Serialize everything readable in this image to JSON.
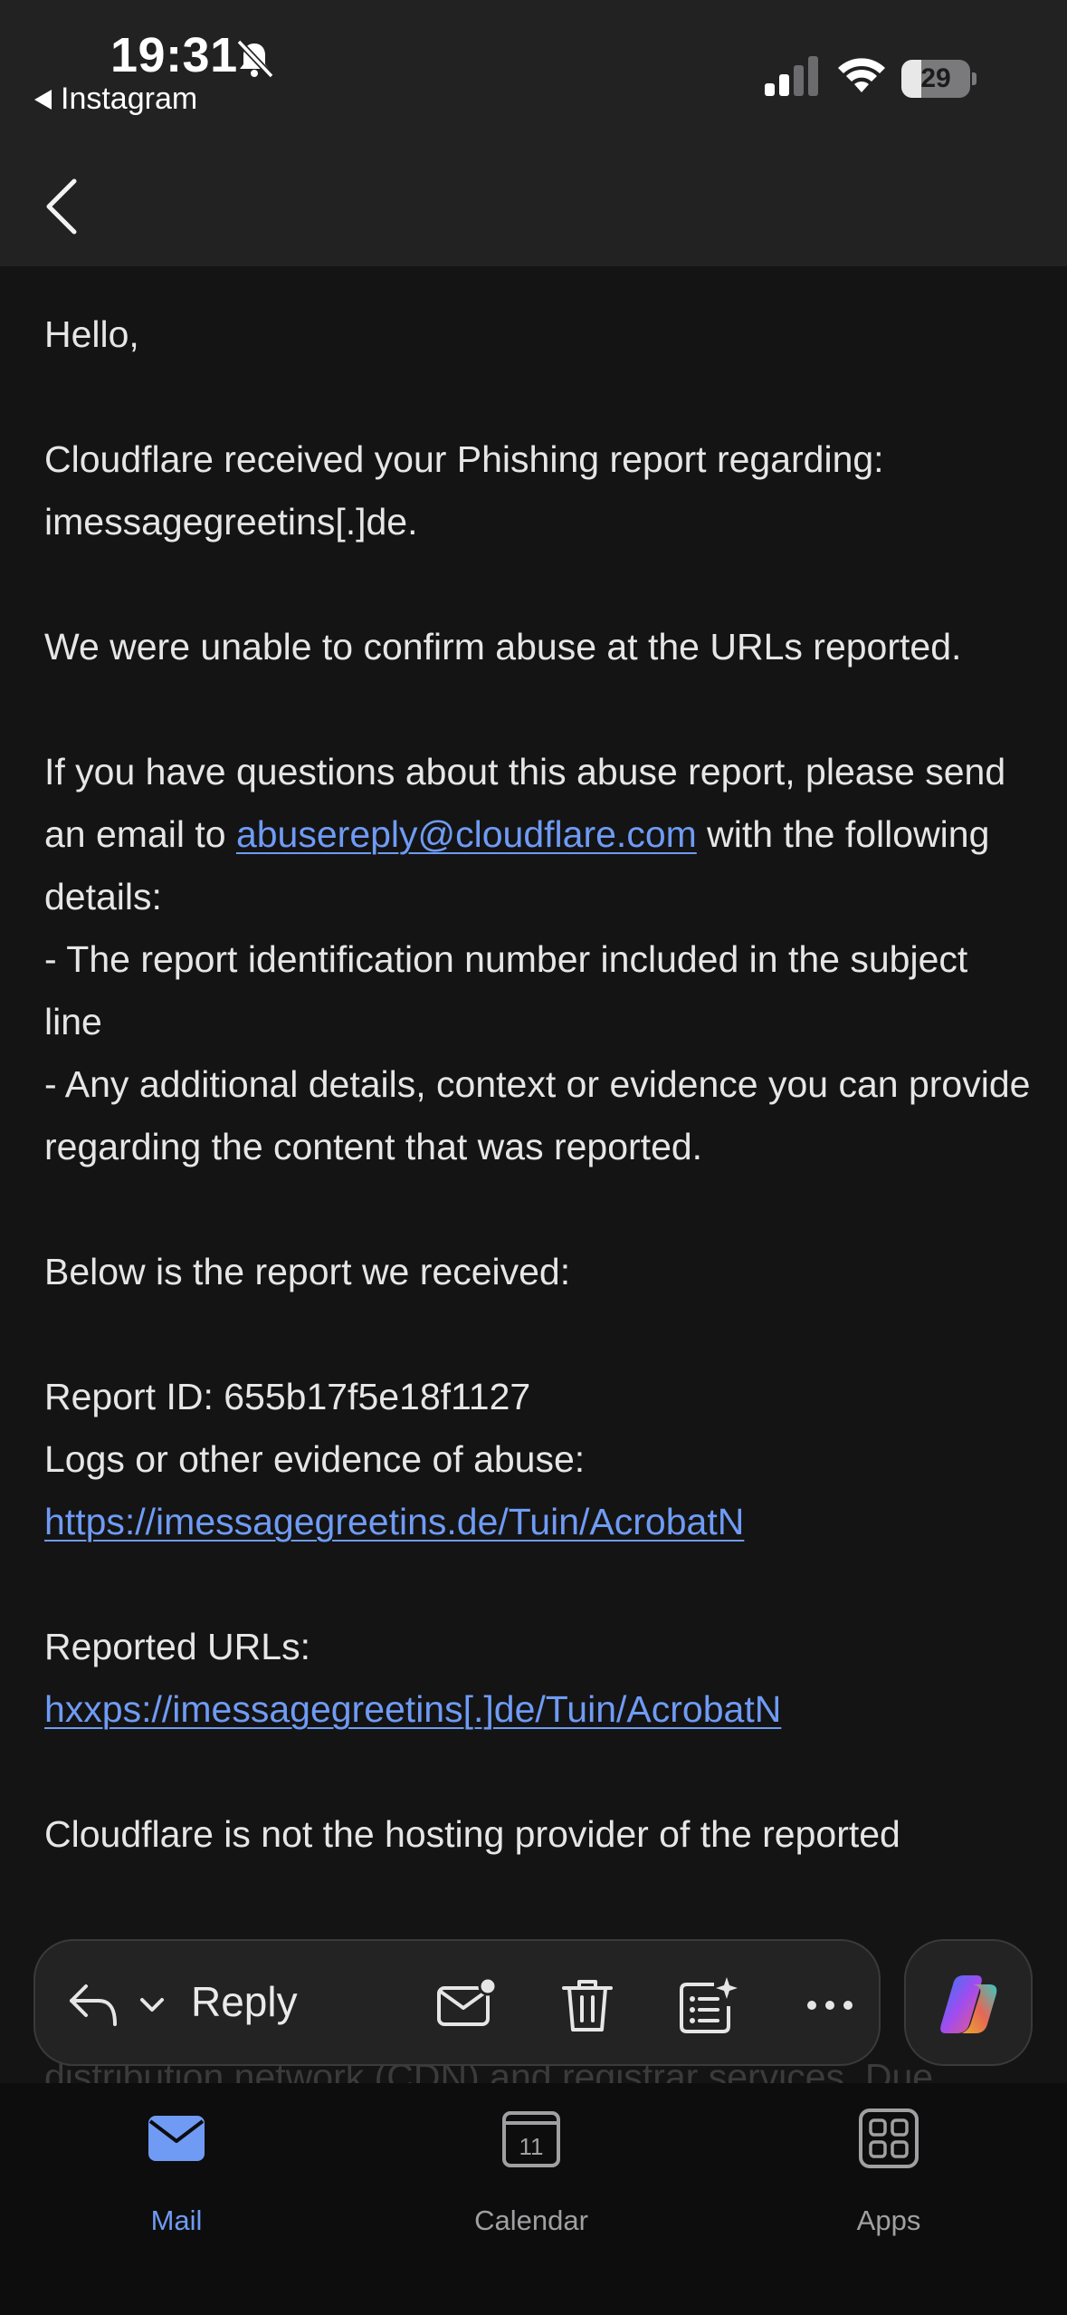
{
  "status_bar": {
    "time": "19:31",
    "back_app": "Instagram",
    "battery": "29",
    "battery_level": 0.29
  },
  "email": {
    "greeting": "Hello,",
    "p1_line1": "Cloudflare received your Phishing report regarding:",
    "p1_line2": "imessagegreetins[.]de.",
    "p2": "We were unable to confirm abuse at the URLs reported.",
    "p3_before": "If you have questions about this abuse report, please send an email to ",
    "p3_email": "abusereply@cloudflare.com",
    "p3_after": " with the following details:",
    "bullet1": "- The report identification number included in the subject line",
    "bullet2": "- Any additional details, context or evidence you can provide regarding the content that was reported.",
    "p4": "Below is the report we received:",
    "report_id": "Report ID: 655b17f5e18f1127",
    "logs_label": "Logs or other evidence of abuse:",
    "logs_link": "https://imessagegreetins.de/Tuin/AcrobatN",
    "reported_urls_label": "Reported URLs:",
    "reported_url": "hxxps://imessagegreetins[.]de/Tuin/AcrobatN",
    "p5_partial": "Cloudflare is not the hosting provider of the reported",
    "peek_line": "distribution network (CDN) and registrar services. Due"
  },
  "action_bar": {
    "reply_label": "Reply"
  },
  "tabs": [
    {
      "label": "Mail",
      "icon": "mail-icon",
      "active": true
    },
    {
      "label": "Calendar",
      "icon": "calendar-icon",
      "day": "11",
      "active": false
    },
    {
      "label": "Apps",
      "icon": "apps-grid-icon",
      "active": false
    }
  ],
  "colors": {
    "link": "#6f9bf5",
    "header_bg": "#222223",
    "body_bg": "#141414",
    "active_tab": "#6f9bf5"
  }
}
